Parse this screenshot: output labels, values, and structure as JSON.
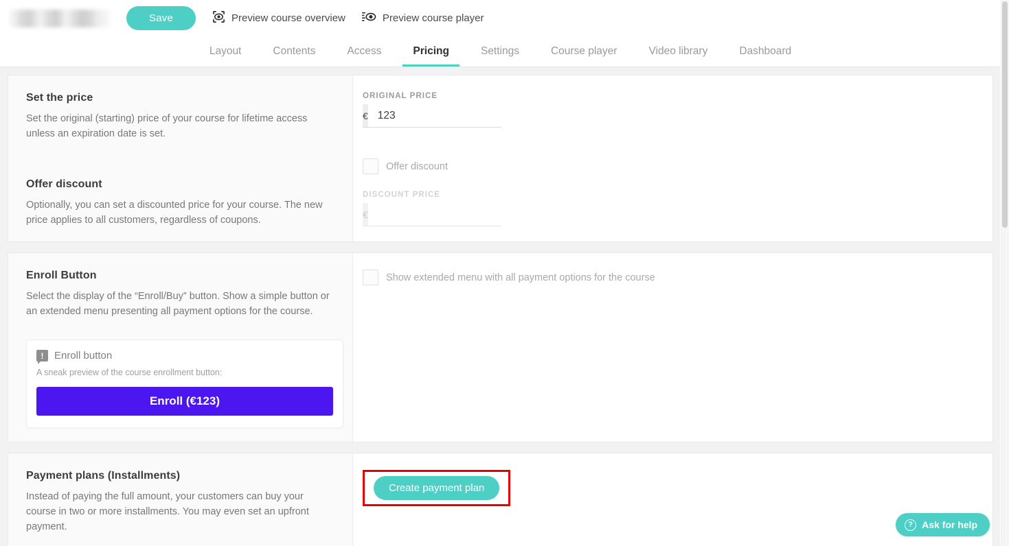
{
  "topbar": {
    "course_title": "",
    "save_label": "Save",
    "preview_overview_label": "Preview course overview",
    "preview_player_label": "Preview course player",
    "preview_overview_icon": "eye-frame-icon",
    "preview_player_icon": "eye-player-icon"
  },
  "tabs": [
    {
      "label": "Layout",
      "active": false
    },
    {
      "label": "Contents",
      "active": false
    },
    {
      "label": "Access",
      "active": false
    },
    {
      "label": "Pricing",
      "active": true
    },
    {
      "label": "Settings",
      "active": false
    },
    {
      "label": "Course player",
      "active": false
    },
    {
      "label": "Video library",
      "active": false
    },
    {
      "label": "Dashboard",
      "active": false
    }
  ],
  "sections": {
    "price": {
      "title": "Set the price",
      "desc": "Set the original (starting) price of your course for lifetime access unless an expiration date is set.",
      "discount_title": "Offer discount",
      "discount_desc": "Optionally, you can set a discounted price for your course. The new price applies to all customers, regardless of coupons.",
      "original_price_label": "ORIGINAL PRICE",
      "original_price_currency": "€",
      "original_price_value": "123",
      "offer_discount_checkbox_label": "Offer discount",
      "offer_discount_checked": false,
      "discount_price_label": "DISCOUNT PRICE",
      "discount_price_currency": "€",
      "discount_price_value": "",
      "discount_price_placeholder": ""
    },
    "enroll": {
      "title": "Enroll Button",
      "desc": "Select the display of the “Enroll/Buy” button. Show a simple button or an extended menu presenting all payment options for the course.",
      "extended_menu_checkbox_label": "Show extended menu with all payment options for the course",
      "extended_menu_checked": false,
      "preview_title": "Enroll button",
      "preview_sub": "A sneak preview of the course enrollment button:",
      "preview_button_label": "Enroll (€123)",
      "preview_button_color": "#4b16ef",
      "tip_icon_glyph": "!"
    },
    "payment_plans": {
      "title": "Payment plans (Installments)",
      "desc": "Instead of paying the full amount, your customers can buy your course in two or more installments. You may even set an upfront payment.",
      "create_button_label": "Create payment plan",
      "highlight_color": "#e60000"
    }
  },
  "help": {
    "label": "Ask for help",
    "icon_glyph": "?",
    "icon_name": "question-circle-icon"
  },
  "theme": {
    "accent": "#4dcfc6",
    "page_background": "#f2f2f2",
    "card_background": "#ffffff",
    "left_column_background": "#fafafa"
  }
}
